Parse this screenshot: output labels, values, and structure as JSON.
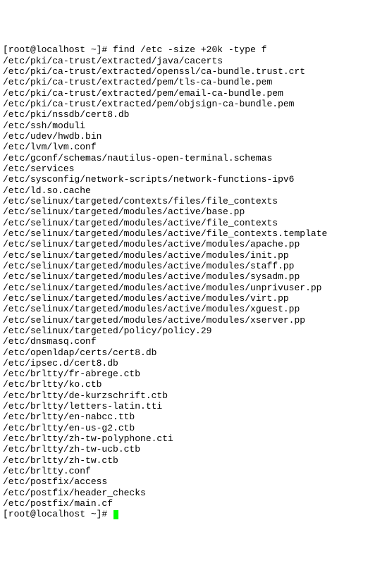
{
  "prompt1": "[root@localhost ~]# ",
  "command": "find /etc -size +20k -type f",
  "output": [
    "/etc/pki/ca-trust/extracted/java/cacerts",
    "/etc/pki/ca-trust/extracted/openssl/ca-bundle.trust.crt",
    "/etc/pki/ca-trust/extracted/pem/tls-ca-bundle.pem",
    "/etc/pki/ca-trust/extracted/pem/email-ca-bundle.pem",
    "/etc/pki/ca-trust/extracted/pem/objsign-ca-bundle.pem",
    "/etc/pki/nssdb/cert8.db",
    "/etc/ssh/moduli",
    "/etc/udev/hwdb.bin",
    "/etc/lvm/lvm.conf",
    "/etc/gconf/schemas/nautilus-open-terminal.schemas",
    "/etc/services",
    "/etc/sysconfig/network-scripts/network-functions-ipv6",
    "/etc/ld.so.cache",
    "/etc/selinux/targeted/contexts/files/file_contexts",
    "/etc/selinux/targeted/modules/active/base.pp",
    "/etc/selinux/targeted/modules/active/file_contexts",
    "/etc/selinux/targeted/modules/active/file_contexts.template",
    "/etc/selinux/targeted/modules/active/modules/apache.pp",
    "/etc/selinux/targeted/modules/active/modules/init.pp",
    "/etc/selinux/targeted/modules/active/modules/staff.pp",
    "/etc/selinux/targeted/modules/active/modules/sysadm.pp",
    "/etc/selinux/targeted/modules/active/modules/unprivuser.pp",
    "/etc/selinux/targeted/modules/active/modules/virt.pp",
    "/etc/selinux/targeted/modules/active/modules/xguest.pp",
    "/etc/selinux/targeted/modules/active/modules/xserver.pp",
    "/etc/selinux/targeted/policy/policy.29",
    "/etc/dnsmasq.conf",
    "/etc/openldap/certs/cert8.db",
    "/etc/ipsec.d/cert8.db",
    "/etc/brltty/fr-abrege.ctb",
    "/etc/brltty/ko.ctb",
    "/etc/brltty/de-kurzschrift.ctb",
    "/etc/brltty/letters-latin.tti",
    "/etc/brltty/en-nabcc.ttb",
    "/etc/brltty/en-us-g2.ctb",
    "/etc/brltty/zh-tw-polyphone.cti",
    "/etc/brltty/zh-tw-ucb.ctb",
    "/etc/brltty/zh-tw.ctb",
    "/etc/brltty.conf",
    "/etc/postfix/access",
    "/etc/postfix/header_checks",
    "/etc/postfix/main.cf"
  ],
  "prompt2": "[root@localhost ~]# "
}
